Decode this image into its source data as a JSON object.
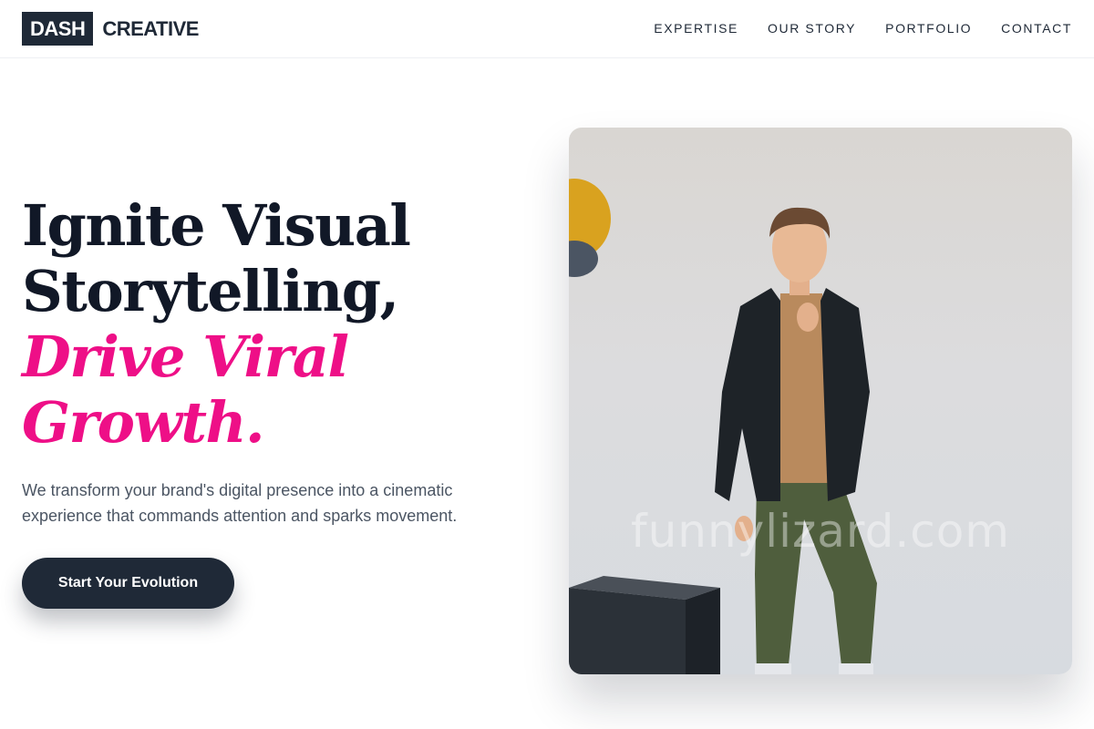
{
  "brand": {
    "box_text": "DASH",
    "text": "CREATIVE"
  },
  "nav": {
    "items": [
      {
        "label": "EXPERTISE"
      },
      {
        "label": "OUR STORY"
      },
      {
        "label": "PORTFOLIO"
      },
      {
        "label": "CONTACT"
      }
    ]
  },
  "hero": {
    "headline_line1": "Ignite Visual",
    "headline_line2": "Storytelling,",
    "headline_accent_line1": "Drive Viral",
    "headline_accent_line2": "Growth.",
    "subtext": "We transform your brand's digital presence into a cinematic experience that commands attention and sparks movement.",
    "cta_label": "Start Your Evolution"
  },
  "image": {
    "watermark": "funnylizard.com"
  },
  "colors": {
    "accent": "#ee0f87",
    "dark": "#1f2937",
    "text_muted": "#4b5563"
  }
}
